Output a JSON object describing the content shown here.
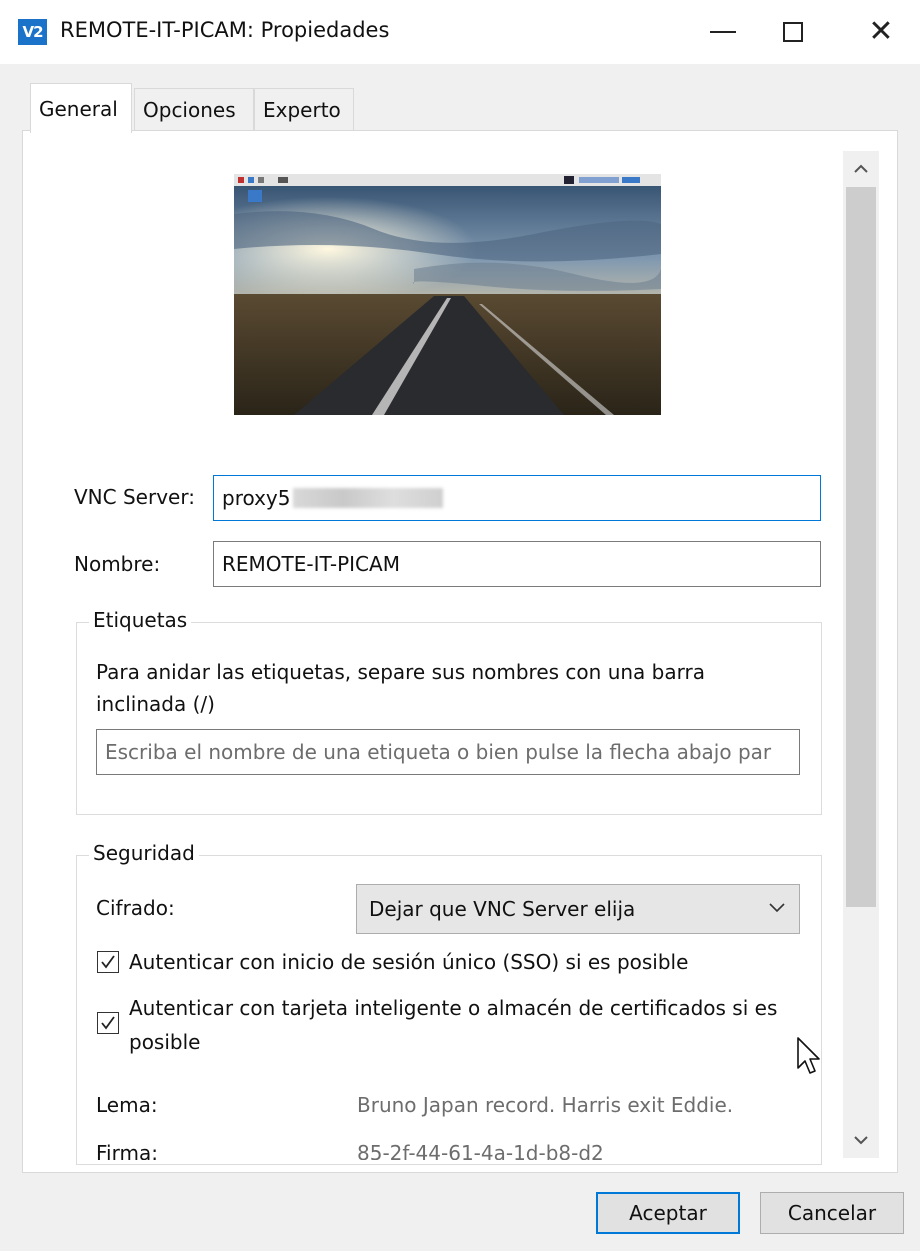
{
  "window": {
    "icon_text": "V2",
    "title": "REMOTE-IT-PICAM: Propiedades",
    "close_glyph": "✕"
  },
  "tabs": [
    {
      "label": "General",
      "active": true
    },
    {
      "label": "Opciones",
      "active": false
    },
    {
      "label": "Experto",
      "active": false
    }
  ],
  "form": {
    "vnc_server_label": "VNC Server:",
    "vnc_server_value": "proxy5",
    "name_label": "Nombre:",
    "name_value": "REMOTE-IT-PICAM"
  },
  "tags": {
    "legend": "Etiquetas",
    "description": "Para anidar las etiquetas, separe sus nombres con una barra inclinada (/)",
    "input_placeholder": "Escriba el nombre de una etiqueta o bien pulse la flecha abajo par"
  },
  "security": {
    "legend": "Seguridad",
    "encryption_label": "Cifrado:",
    "encryption_value": "Dejar que VNC Server elija",
    "sso_label": "Autenticar con inicio de sesión único (SSO) si es posible",
    "sso_checked": true,
    "smartcard_label": "Autenticar con tarjeta inteligente o almacén de certificados si es posible",
    "smartcard_checked": true,
    "motto_label": "Lema:",
    "motto_value": "Bruno Japan record. Harris exit Eddie.",
    "signature_label": "Firma:",
    "signature_value": "85-2f-44-61-4a-1d-b8-d2"
  },
  "buttons": {
    "accept": "Aceptar",
    "cancel": "Cancelar"
  },
  "colors": {
    "accent": "#0078d7",
    "app_icon": "#1a73c8"
  },
  "icons": {
    "app": "vnc-viewer-icon",
    "minimize": "minimize-icon",
    "maximize": "maximize-icon",
    "close": "close-icon",
    "scroll_up": "chevron-up-icon",
    "scroll_down": "chevron-down-icon",
    "dropdown": "chevron-down-icon",
    "cursor": "mouse-pointer-icon"
  }
}
